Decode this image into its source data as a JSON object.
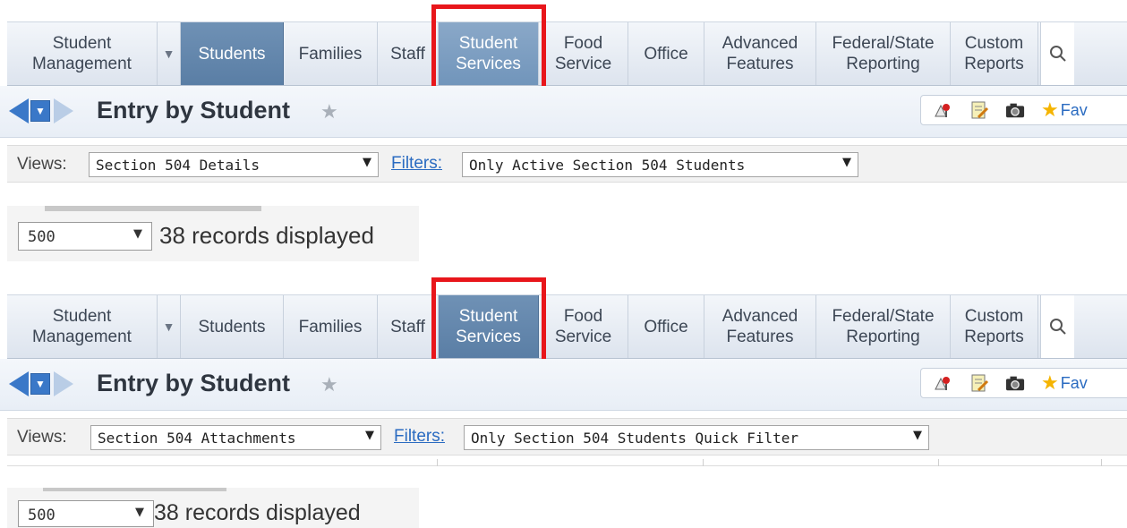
{
  "nav": {
    "tabs": [
      {
        "label_line1": "Student",
        "label_line2": "Management"
      },
      {
        "label": "Students"
      },
      {
        "label": "Families"
      },
      {
        "label": "Staff"
      },
      {
        "label_line1": "Student",
        "label_line2": "Services"
      },
      {
        "label_line1": "Food",
        "label_line2": "Service"
      },
      {
        "label": "Office"
      },
      {
        "label_line1": "Advanced",
        "label_line2": "Features"
      },
      {
        "label_line1": "Federal/State",
        "label_line2": "Reporting"
      },
      {
        "label_line1": "Custom",
        "label_line2": "Reports"
      }
    ],
    "highlight_color": "#e8161b"
  },
  "panels": [
    {
      "title": "Entry by Student",
      "favorites_label": "Fav",
      "views_label": "Views:",
      "view_value": "Section 504 Details",
      "filters_label": "Filters:",
      "filter_value": "Only Active Section 504 Students",
      "page_size": "500",
      "record_count": "38 records displayed"
    },
    {
      "title": "Entry by Student",
      "favorites_label": "Fav",
      "views_label": "Views:",
      "view_value": "Section 504 Attachments",
      "filters_label": "Filters:",
      "filter_value": "Only Section 504 Students Quick Filter",
      "page_size": "500",
      "record_count": "38 records displayed"
    }
  ],
  "colors": {
    "accent": "#5a7ea5",
    "link": "#2a6bc1"
  }
}
